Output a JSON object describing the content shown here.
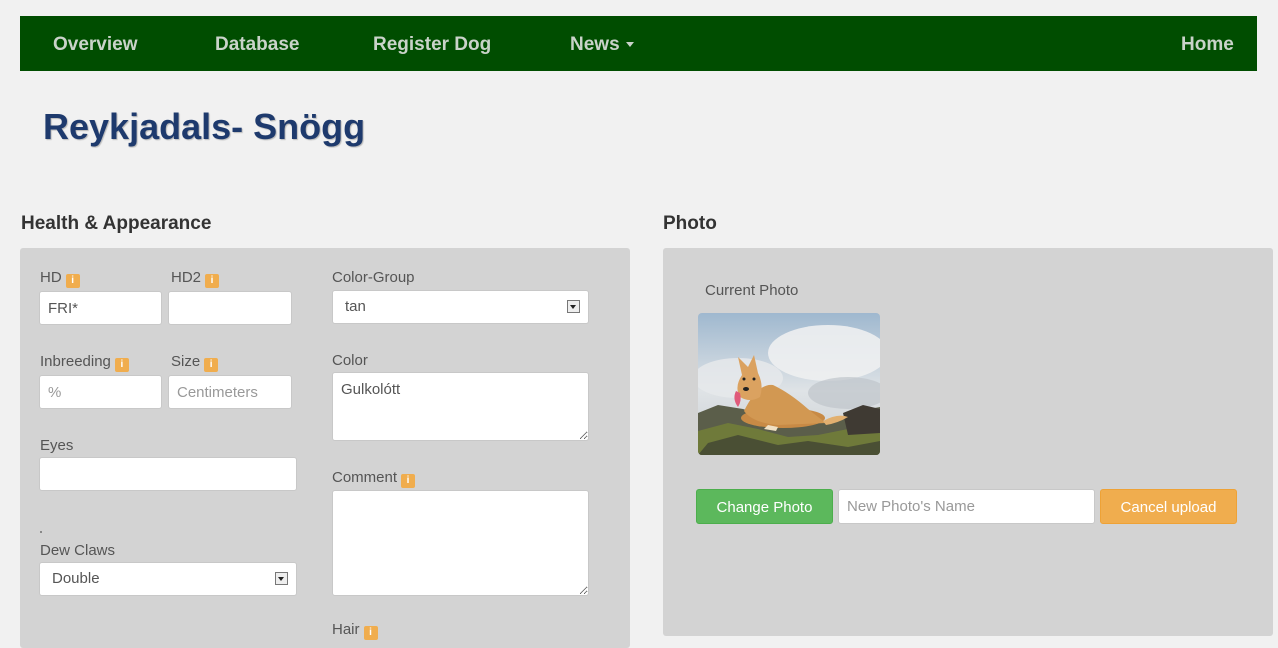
{
  "nav": {
    "overview": "Overview",
    "database": "Database",
    "register_dog": "Register Dog",
    "news": "News",
    "home": "Home"
  },
  "page_title": "Reykjadals- Snögg",
  "health": {
    "heading": "Health & Appearance",
    "hd_label": "HD",
    "hd_value": "FRI*",
    "hd2_label": "HD2",
    "hd2_value": "",
    "inbreeding_label": "Inbreeding",
    "inbreeding_placeholder": "%",
    "size_label": "Size",
    "size_placeholder": "Centimeters",
    "eyes_label": "Eyes",
    "eyes_value": "",
    "dew_claws_label": "Dew Claws",
    "dew_claws_value": "Double",
    "color_group_label": "Color-Group",
    "color_group_value": "tan",
    "color_label": "Color",
    "color_value": "Gulkolótt",
    "comment_label": "Comment",
    "comment_value": "",
    "hair_label": "Hair",
    "info_glyph": "i"
  },
  "photo": {
    "heading": "Photo",
    "current_photo_label": "Current Photo",
    "change_photo_label": "Change Photo",
    "new_name_placeholder": "New Photo's Name",
    "cancel_upload_label": "Cancel upload"
  },
  "colors": {
    "navbar": "#004d00",
    "title": "#1e3a6d",
    "panel": "#d3d3d3",
    "info_badge": "#f0ad4e",
    "green_button": "#5cb85c",
    "orange_button": "#f0ad4e"
  },
  "icons": {
    "info": "info-icon",
    "caret": "caret-down-icon",
    "select_arrow": "select-arrow-icon",
    "resize_grip": "resize-grip-icon"
  }
}
